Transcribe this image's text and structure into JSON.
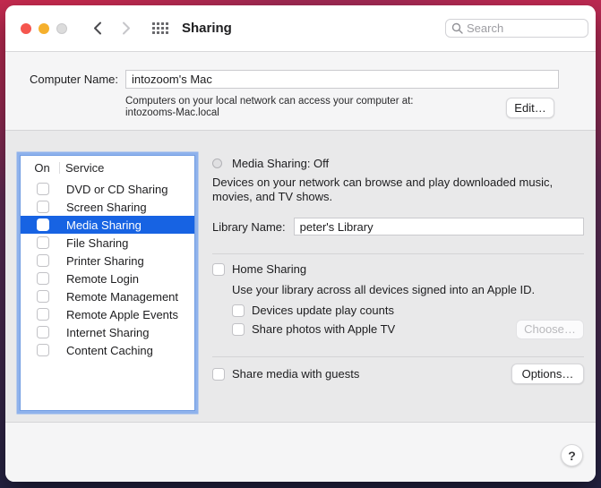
{
  "titlebar": {
    "title": "Sharing",
    "search_placeholder": "Search"
  },
  "computer_name": {
    "label": "Computer Name:",
    "value": "intozoom's Mac",
    "helper_line1": "Computers on your local network can access your computer at:",
    "helper_line2": "intozooms-Mac.local",
    "edit_button": "Edit…"
  },
  "services": {
    "on_header": "On",
    "service_header": "Service",
    "items": [
      {
        "label": "DVD or CD Sharing",
        "on": false,
        "selected": false
      },
      {
        "label": "Screen Sharing",
        "on": false,
        "selected": false
      },
      {
        "label": "Media Sharing",
        "on": false,
        "selected": true
      },
      {
        "label": "File Sharing",
        "on": false,
        "selected": false
      },
      {
        "label": "Printer Sharing",
        "on": false,
        "selected": false
      },
      {
        "label": "Remote Login",
        "on": false,
        "selected": false
      },
      {
        "label": "Remote Management",
        "on": false,
        "selected": false
      },
      {
        "label": "Remote Apple Events",
        "on": false,
        "selected": false
      },
      {
        "label": "Internet Sharing",
        "on": false,
        "selected": false
      },
      {
        "label": "Content Caching",
        "on": false,
        "selected": false
      }
    ]
  },
  "panel": {
    "status": "Media Sharing: Off",
    "description": "Devices on your network can browse and play downloaded music, movies, and TV shows.",
    "library_label": "Library Name:",
    "library_value": "peter's Library",
    "home_sharing_label": "Home Sharing",
    "home_sharing_checked": false,
    "home_sharing_description": "Use your library across all devices signed into an Apple ID.",
    "sub_option_play_counts": "Devices update play counts",
    "sub_option_play_counts_checked": false,
    "sub_option_photos": "Share photos with Apple TV",
    "sub_option_photos_checked": false,
    "choose_button": "Choose…",
    "guests_label": "Share media with guests",
    "guests_checked": false,
    "options_button": "Options…"
  },
  "footer": {
    "help_button": "?"
  },
  "colors": {
    "selection_blue": "#1763e3",
    "focus_ring": "#8fb2ec",
    "titlebar_bg": "#ffffff",
    "section_bg": "#f5f5f6",
    "content_bg": "#e9e9ea",
    "traffic_red": "#f5564e",
    "traffic_yellow": "#f5b02d",
    "traffic_gray": "#dcdcdc",
    "wallpaper_top": "#c92a4e",
    "wallpaper_bottom": "#242343"
  }
}
